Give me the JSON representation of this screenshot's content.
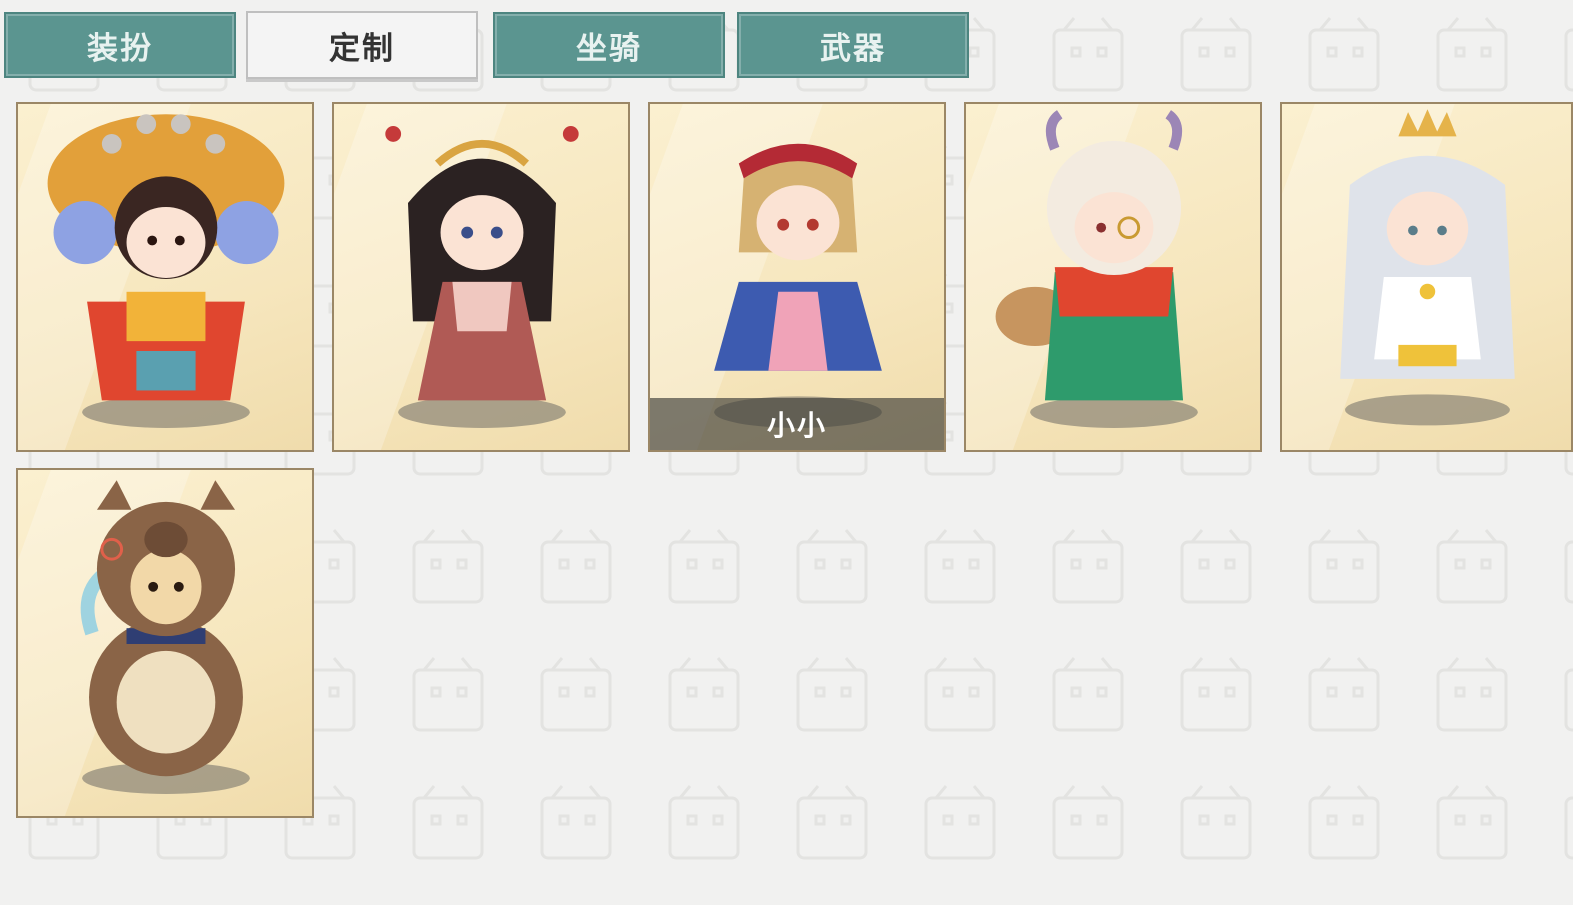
{
  "tabs": [
    {
      "label": "装扮",
      "active": false
    },
    {
      "label": "定制",
      "active": true
    },
    {
      "label": "坐骑",
      "active": false
    },
    {
      "label": "武器",
      "active": false
    }
  ],
  "skins": [
    {
      "name": "opera-queen-skin",
      "caption": "",
      "accent": "#e0462f"
    },
    {
      "name": "ancient-princess-skin",
      "caption": "",
      "accent": "#b05a55"
    },
    {
      "name": "lolita-girl-skin",
      "caption": "小小",
      "accent": "#3d5bb0"
    },
    {
      "name": "sheep-scholar-skin",
      "caption": "",
      "accent": "#2e9b6c"
    },
    {
      "name": "silver-hair-queen-skin",
      "caption": "",
      "accent": "#e9e9ee"
    },
    {
      "name": "bear-costume-skin",
      "caption": "",
      "accent": "#8a6447"
    }
  ],
  "colors": {
    "tab_inactive": "#5b9590",
    "tab_active": "#f4f4f4",
    "card_border": "#9b8766",
    "card_bg": "#f6e6bd"
  }
}
